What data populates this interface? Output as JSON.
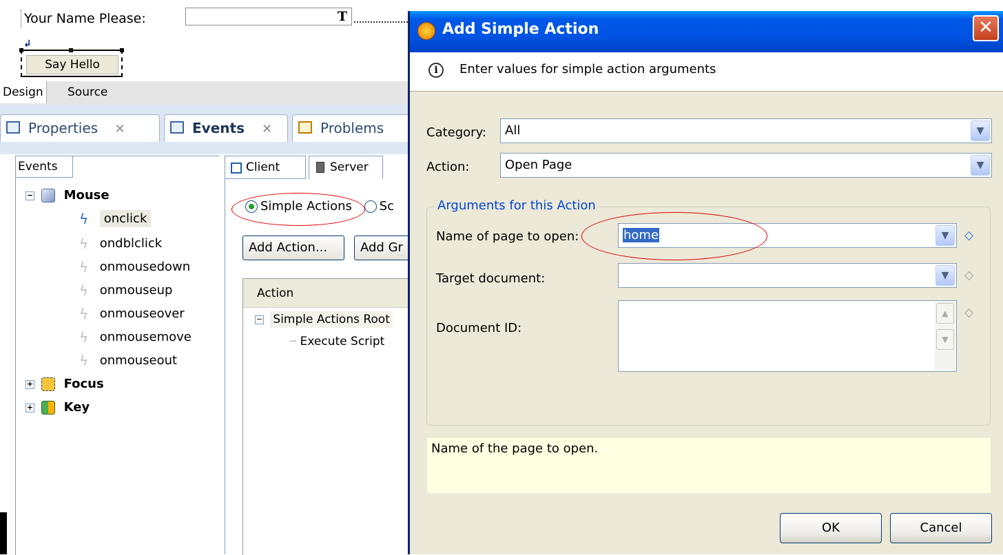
{
  "design": {
    "name_label": "Your Name Please:",
    "input_type_glyph": "T",
    "say_hello_label": "Say Hello",
    "newline_glyph": "↲"
  },
  "editor_tabs": [
    "Design",
    "Source"
  ],
  "views": [
    {
      "label": "Properties",
      "icon": "properties-icon"
    },
    {
      "label": "Events",
      "icon": "events-icon"
    },
    {
      "label": "Problems",
      "icon": "problems-icon"
    }
  ],
  "events_panel": {
    "header": "Events",
    "categories": [
      {
        "label": "Mouse",
        "expanded": true,
        "icon": "mouse-icon",
        "items": [
          "onclick",
          "ondblclick",
          "onmousedown",
          "onmouseup",
          "onmouseover",
          "onmousemove",
          "onmouseout"
        ],
        "selected": "onclick"
      },
      {
        "label": "Focus",
        "expanded": false,
        "icon": "focus-icon"
      },
      {
        "label": "Key",
        "expanded": false,
        "icon": "key-icon"
      }
    ]
  },
  "actions_panel": {
    "tabs": [
      "Client",
      "Server"
    ],
    "radio_simple": "Simple Actions",
    "radio_script": "Sc",
    "add_action_label": "Add Action...",
    "add_group_label": "Add Gr",
    "table_header": "Action",
    "tree_root": "Simple Actions Root",
    "tree_child": "Execute Script"
  },
  "dialog": {
    "title": "Add Simple Action",
    "close_glyph": "✕",
    "info_text": "Enter values for simple action arguments",
    "category_label": "Category:",
    "category_value": "All",
    "action_label": "Action:",
    "action_value": "Open Page",
    "group_title": "Arguments for this Action",
    "page_name_label": "Name of page to open:",
    "page_name_value": "home",
    "target_label": "Target document:",
    "target_value": "",
    "docid_label": "Document ID:",
    "help_text": "Name of the page to open.",
    "ok_label": "OK",
    "cancel_label": "Cancel"
  },
  "colors": {
    "titlebar": "#0054e3",
    "dialog_bg": "#ece9d8",
    "highlight_oval": "#e00000",
    "link_blue": "#0046d5"
  }
}
